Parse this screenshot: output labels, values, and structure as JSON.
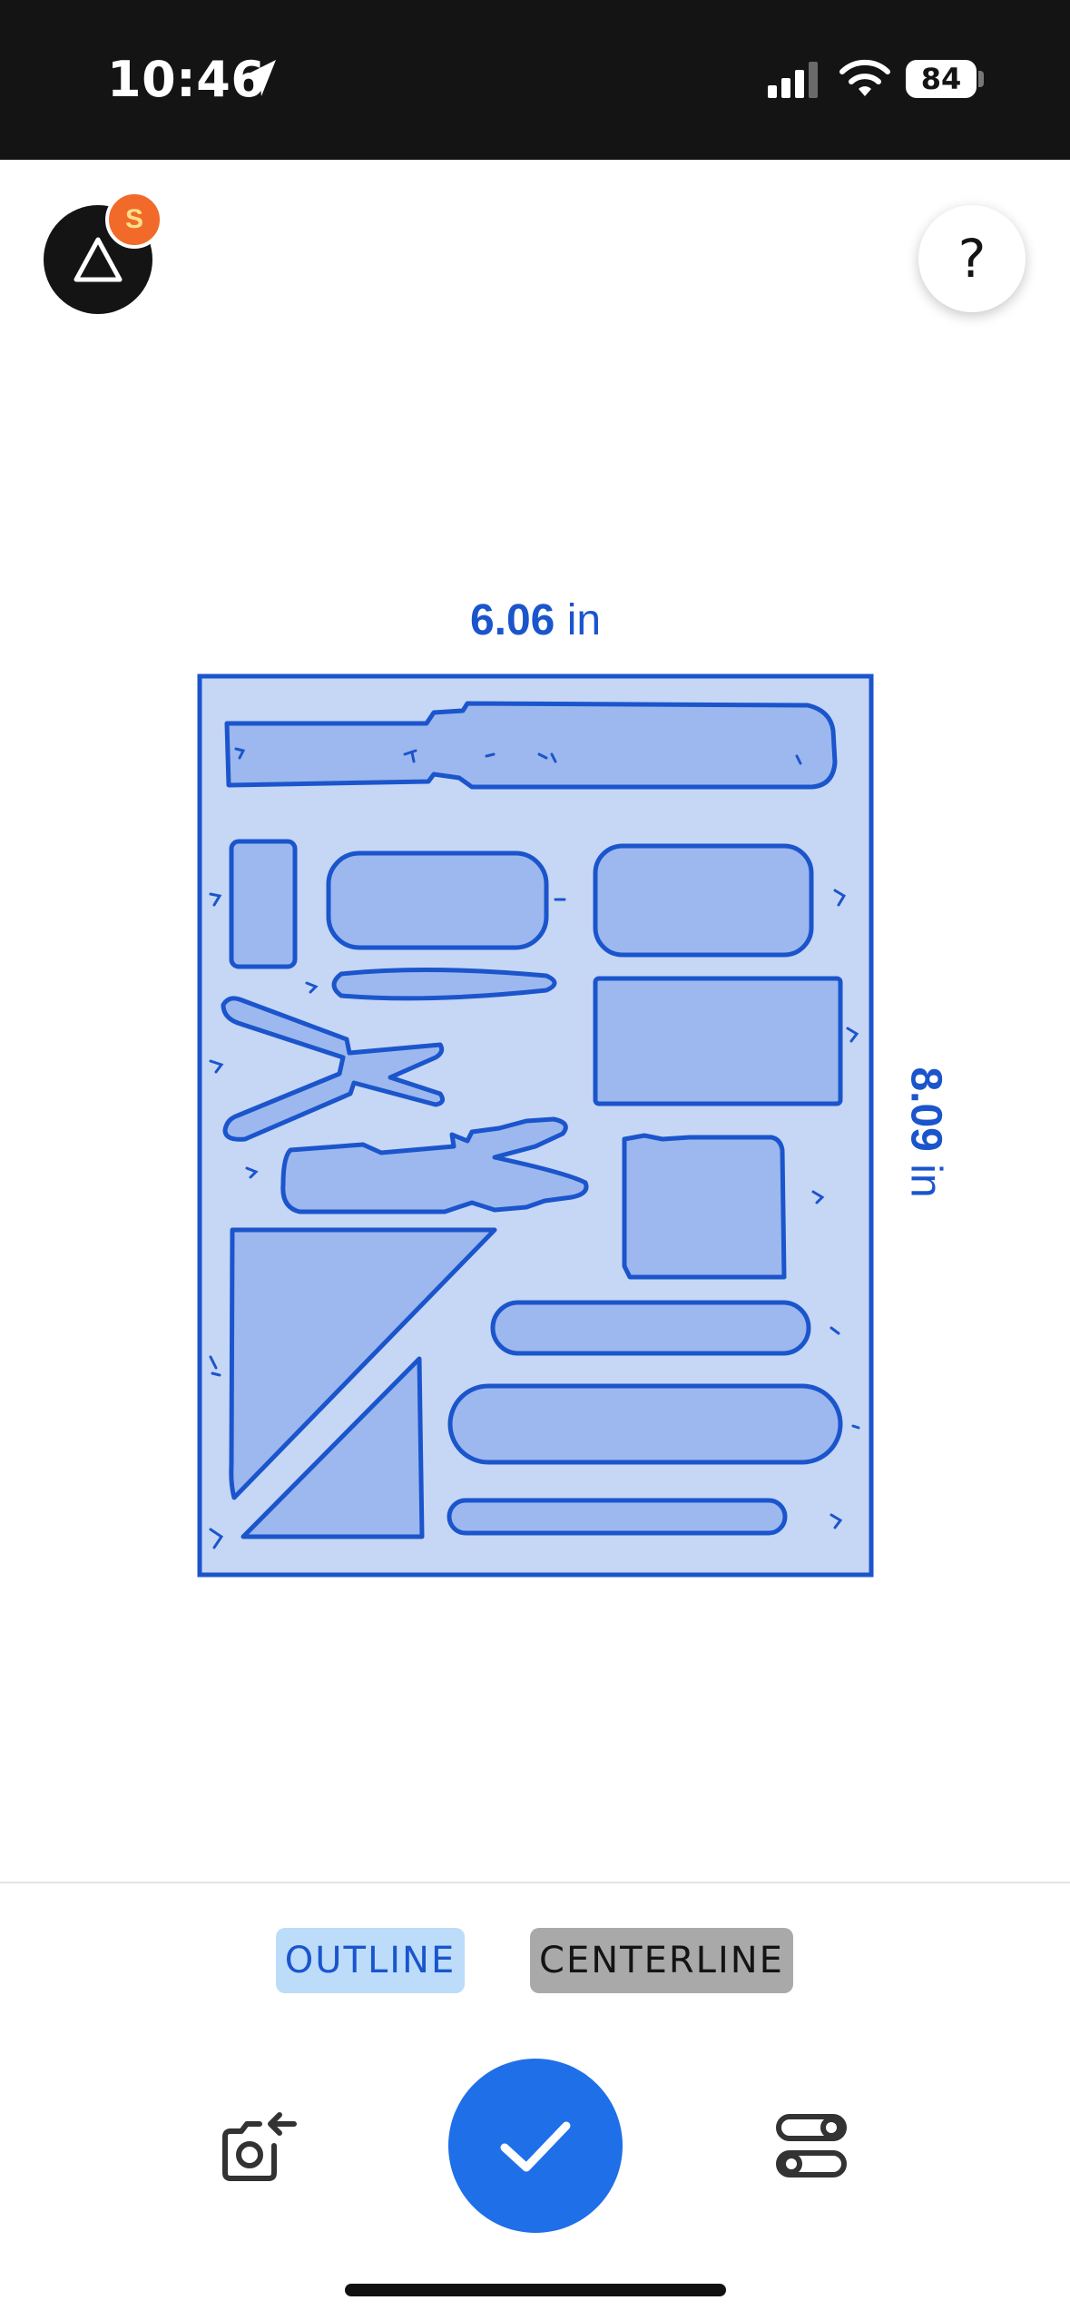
{
  "status_bar": {
    "time": "10:46",
    "battery": "84",
    "icons": [
      "location-arrow-icon",
      "signal-icon",
      "wifi-icon",
      "battery-icon"
    ]
  },
  "header": {
    "logo_icon": "triangle-logo-icon",
    "badge": "S",
    "help_label": "?"
  },
  "measurement": {
    "width_value": "6.06",
    "width_unit": "in",
    "height_value": "8.09",
    "height_unit": "in"
  },
  "modes": {
    "outline_label": "OUTLINE",
    "centerline_label": "CENTERLINE",
    "selected": "OUTLINE"
  },
  "toolbar": {
    "retake_icon": "camera-retake-icon",
    "confirm_icon": "checkmark-icon",
    "settings_icon": "sliders-toggle-icon"
  },
  "colors": {
    "accent": "#1f6fe8",
    "trace_line": "#1b55cc",
    "trace_fill": "#c6d6f5",
    "shape_fill": "#9db8ee",
    "badge": "#f26a2a",
    "outline_chip": "#bcdcfa",
    "centerline_chip": "#a9a9a9"
  }
}
